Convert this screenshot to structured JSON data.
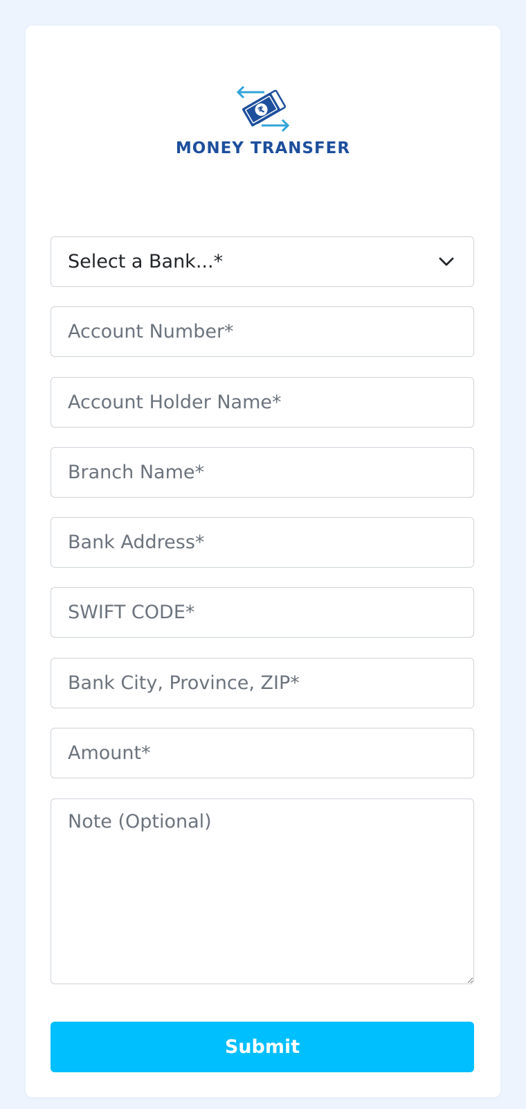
{
  "brand": {
    "name": "MONEY TRANSFER",
    "logo_icon": "rupee-money-transfer-icon"
  },
  "form": {
    "bank_select": {
      "selected": "Select a Bank...*",
      "icon": "chevron-down-icon"
    },
    "fields": {
      "account_number": {
        "placeholder": "Account Number*",
        "value": ""
      },
      "account_holder_name": {
        "placeholder": "Account Holder Name*",
        "value": ""
      },
      "branch_name": {
        "placeholder": "Branch Name*",
        "value": ""
      },
      "bank_address": {
        "placeholder": "Bank Address*",
        "value": ""
      },
      "swift_code": {
        "placeholder": "SWIFT CODE*",
        "value": ""
      },
      "bank_city": {
        "placeholder": "Bank City, Province, ZIP*",
        "value": ""
      },
      "amount": {
        "placeholder": "Amount*",
        "value": ""
      },
      "note": {
        "placeholder": "Note (Optional)",
        "value": ""
      }
    },
    "submit_label": "Submit"
  },
  "colors": {
    "page_background": "#edf4fd",
    "brand_text": "#1d4f9c",
    "logo_arrow": "#2fa4da",
    "submit_button": "#00bfff"
  }
}
